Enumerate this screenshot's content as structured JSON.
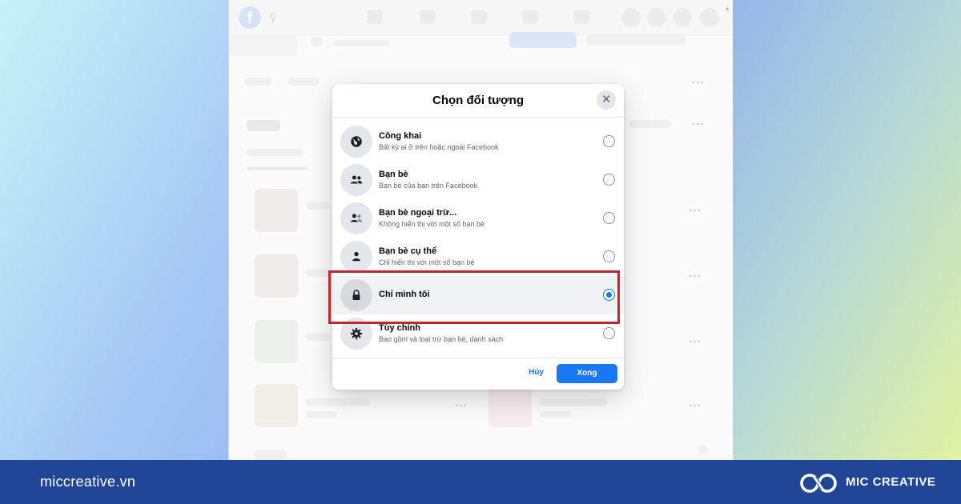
{
  "dialog": {
    "title": "Chọn đối tượng",
    "options": [
      {
        "icon": "globe-icon",
        "title": "Công khai",
        "subtitle": "Bất kỳ ai ở trên hoặc ngoài Facebook",
        "selected": false
      },
      {
        "icon": "friends-icon",
        "title": "Bạn bè",
        "subtitle": "Bạn bè của bạn trên Facebook",
        "selected": false
      },
      {
        "icon": "friends-except-icon",
        "title": "Bạn bè ngoại trừ...",
        "subtitle": "Không hiển thị với một số bạn bè",
        "selected": false
      },
      {
        "icon": "person-icon",
        "title": "Bạn bè cụ thể",
        "subtitle": "Chỉ hiển thị với một số bạn bè",
        "selected": false
      },
      {
        "icon": "lock-icon",
        "title": "Chỉ mình tôi",
        "subtitle": "",
        "selected": true
      },
      {
        "icon": "gear-icon",
        "title": "Tùy chỉnh",
        "subtitle": "Bao gồm và loại trừ bạn bè, danh sách",
        "selected": false
      }
    ],
    "cancel_label": "Hủy",
    "done_label": "Xong"
  },
  "colors": {
    "accent": "#1877f2",
    "highlight_box": "#c0272d",
    "banner": "#1f4597"
  },
  "banner": {
    "site_url": "miccreative.vn",
    "brand_name": "MIC CREATIVE"
  }
}
